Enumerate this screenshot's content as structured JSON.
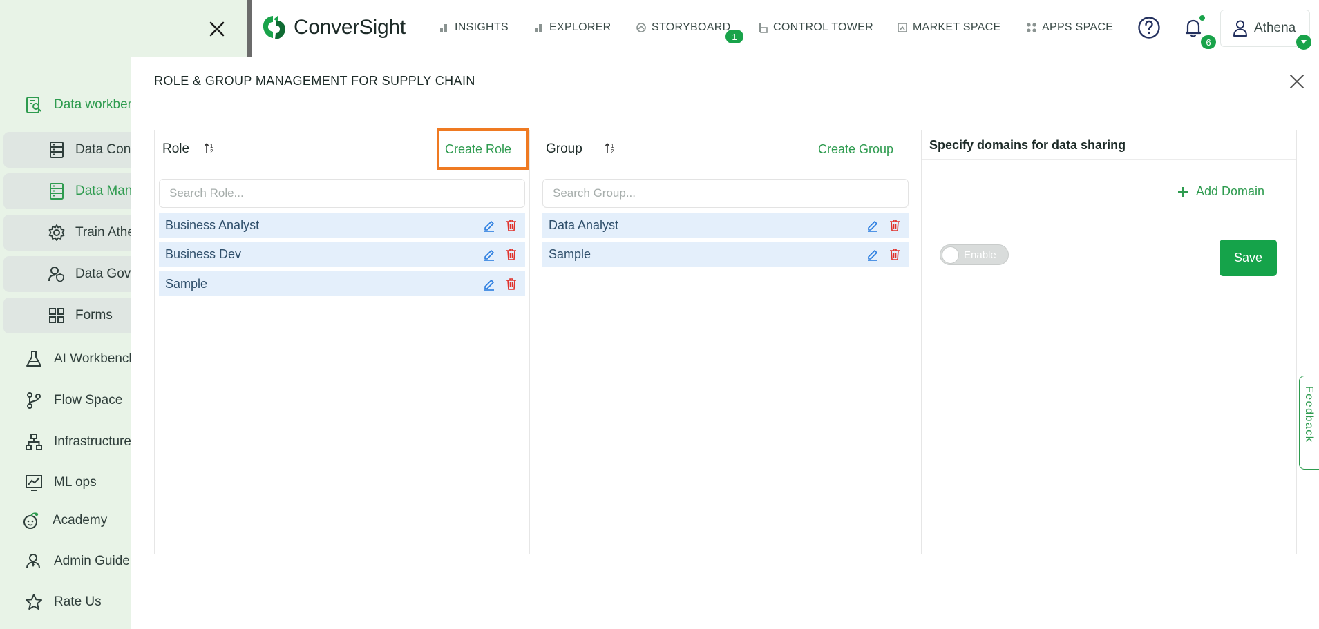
{
  "brand": {
    "name": "ConverSight",
    "accent": "#2e9b4f",
    "highlight": "#ef7a22"
  },
  "nav": [
    {
      "label": "INSIGHTS",
      "icon": "bar-chart-icon"
    },
    {
      "label": "EXPLORER",
      "icon": "bar-chart-icon"
    },
    {
      "label": "STORYBOARD",
      "icon": "storyboard-icon"
    },
    {
      "label": "CONTROL TOWER",
      "icon": "control-tower-icon"
    },
    {
      "label": "MARKET SPACE",
      "icon": "market-space-icon"
    },
    {
      "label": "APPS SPACE",
      "icon": "apps-space-icon"
    }
  ],
  "storyboard_badge": "1",
  "notifications_count": "6",
  "user": {
    "name": "Athena"
  },
  "sidebar": {
    "items": [
      {
        "label": "Data workbench",
        "icon": "data-workbench-icon",
        "active": true
      },
      {
        "label": "Data Connectors",
        "icon": "database-icon"
      },
      {
        "label": "Data Management",
        "icon": "database-icon",
        "active": true
      },
      {
        "label": "Train Athena",
        "icon": "gear-icon"
      },
      {
        "label": "Data Governance",
        "icon": "user-shield-icon"
      },
      {
        "label": "Forms",
        "icon": "grid-icon"
      },
      {
        "label": "AI Workbench",
        "icon": "flask-icon"
      },
      {
        "label": "Flow Space",
        "icon": "branch-icon"
      },
      {
        "label": "Infrastructure",
        "icon": "sitemap-icon"
      },
      {
        "label": "ML ops",
        "icon": "chart-line-icon"
      },
      {
        "label": "Academy",
        "icon": "academy-icon"
      },
      {
        "label": "Admin Guide",
        "icon": "admin-icon"
      },
      {
        "label": "Rate Us",
        "icon": "star-icon"
      }
    ]
  },
  "panel": {
    "title": "ROLE & GROUP MANAGEMENT FOR SUPPLY CHAIN",
    "role": {
      "title": "Role",
      "create_label": "Create Role",
      "search_placeholder": "Search Role...",
      "items": [
        {
          "label": "Business Analyst"
        },
        {
          "label": "Business Dev"
        },
        {
          "label": "Sample"
        }
      ]
    },
    "group": {
      "title": "Group",
      "create_label": "Create Group",
      "search_placeholder": "Search Group...",
      "items": [
        {
          "label": "Data Analyst"
        },
        {
          "label": "Sample"
        }
      ]
    },
    "domains": {
      "title": "Specify domains for data sharing",
      "add_label": "Add Domain",
      "toggle_label": "Enable",
      "toggle_on": false,
      "save_label": "Save"
    }
  },
  "feedback_label": "Feedback"
}
